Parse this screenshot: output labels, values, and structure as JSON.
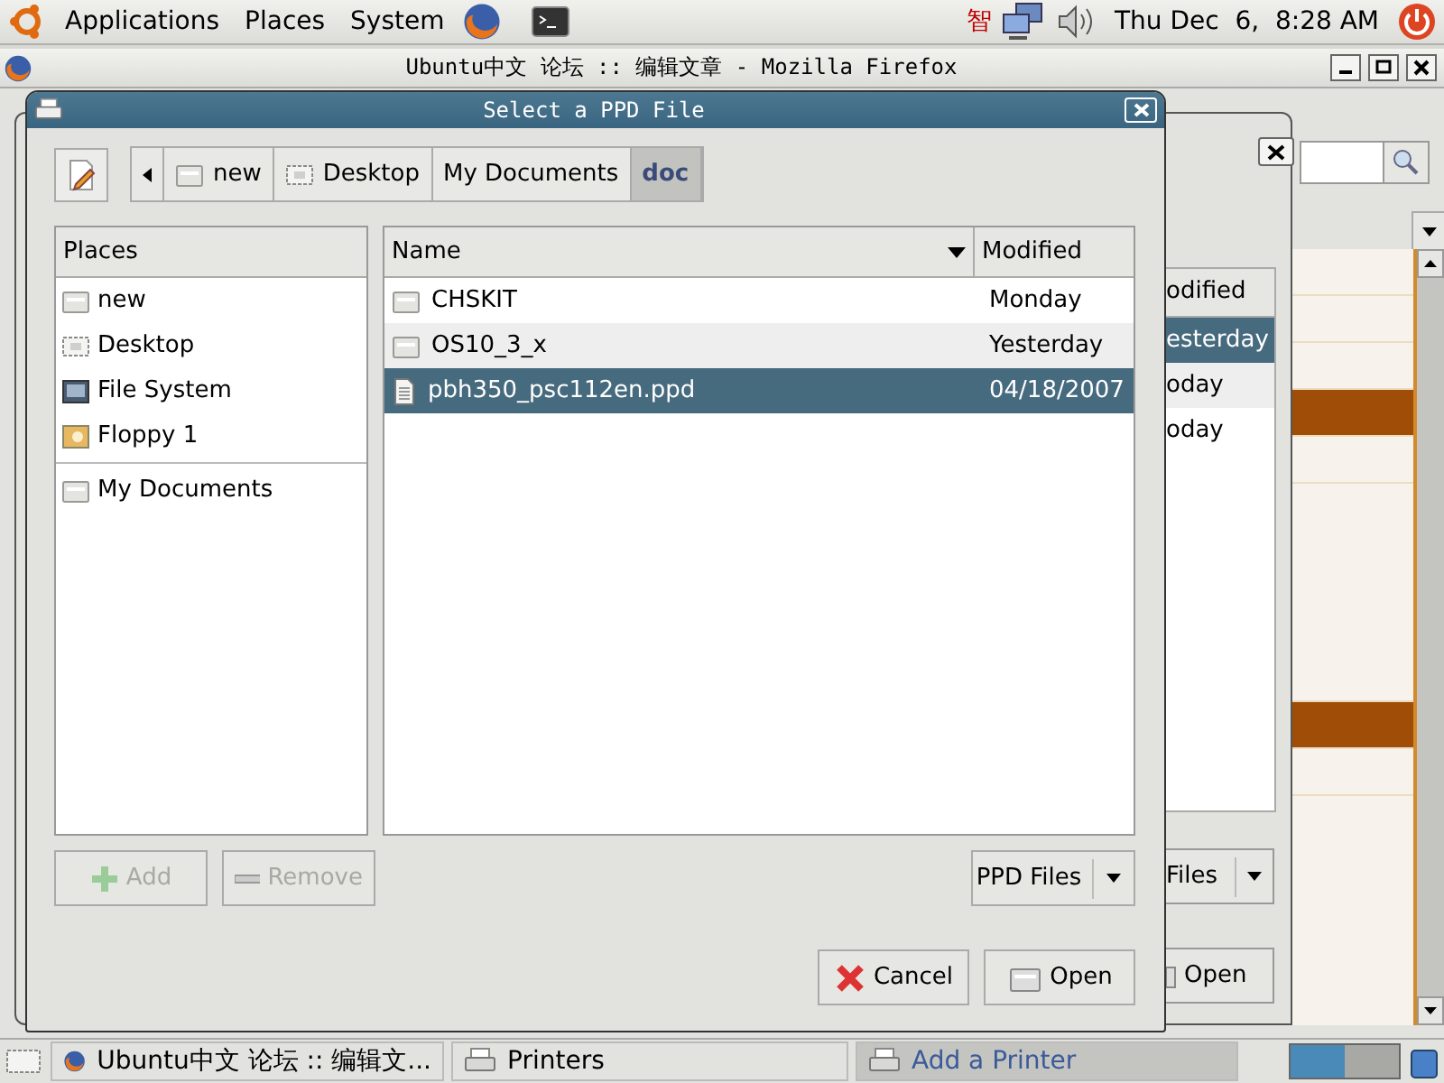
{
  "top_panel": {
    "menus": [
      "Applications",
      "Places",
      "System"
    ],
    "input_method": "智",
    "clock": "Thu Dec  6,  8:28 AM"
  },
  "browser_window": {
    "title": "Ubuntu中文 论坛 :: 编辑文章 - Mozilla Firefox"
  },
  "back_dialog": {
    "column": "odified",
    "rows": [
      {
        "modified": "esterday",
        "selected": true
      },
      {
        "modified": "oday",
        "selected": false
      },
      {
        "modified": "oday",
        "selected": false
      }
    ],
    "filter": "Files",
    "open_button": "Open"
  },
  "dialog": {
    "title": "Select a PPD File",
    "path": [
      {
        "label": "new",
        "kind": "home",
        "selected": false
      },
      {
        "label": "Desktop",
        "kind": "desktop",
        "selected": false
      },
      {
        "label": "My Documents",
        "kind": "plain",
        "selected": false
      },
      {
        "label": "doc",
        "kind": "plain",
        "selected": true
      }
    ],
    "places_header": "Places",
    "places": [
      {
        "label": "new",
        "kind": "home"
      },
      {
        "label": "Desktop",
        "kind": "desktop"
      },
      {
        "label": "File System",
        "kind": "drive"
      },
      {
        "label": "Floppy 1",
        "kind": "floppy"
      },
      {
        "label": "My Documents",
        "kind": "bookmark"
      }
    ],
    "columns": [
      "Name",
      "Modified"
    ],
    "files": [
      {
        "name": "CHSKIT",
        "kind": "folder",
        "modified": "Monday",
        "selected": false
      },
      {
        "name": "OS10_3_x",
        "kind": "folder",
        "modified": "Yesterday",
        "selected": false
      },
      {
        "name": "pbh350_psc112en.ppd",
        "kind": "file",
        "modified": "04/18/2007",
        "selected": true
      }
    ],
    "add_button": {
      "label": "Add",
      "disabled": true
    },
    "remove_button": {
      "label": "Remove",
      "disabled": true
    },
    "filter": "PPD Files",
    "cancel_button": "Cancel",
    "open_button": "Open"
  },
  "taskbar": {
    "tasks": [
      {
        "label": "Ubuntu中文 论坛 :: 编辑文...",
        "kind": "browser",
        "selected": false
      },
      {
        "label": "Printers",
        "kind": "printer",
        "selected": false
      },
      {
        "label": "Add a Printer",
        "kind": "printer",
        "selected": true
      }
    ]
  }
}
